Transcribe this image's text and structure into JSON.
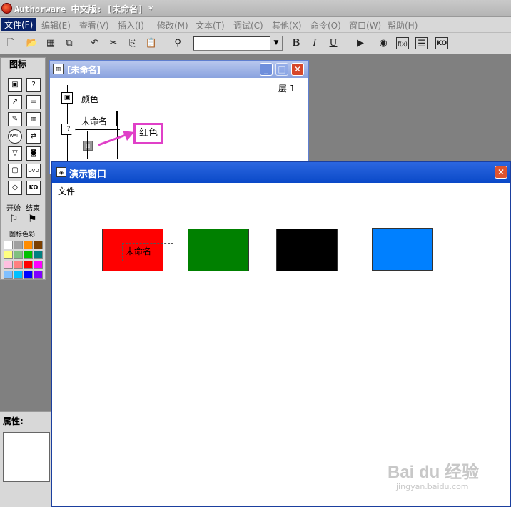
{
  "app": {
    "title": "Authorware 中文版: [未命名] *"
  },
  "menubar": {
    "items": [
      "文件(F)",
      "编辑(E)",
      "查看(V)",
      "插入(I)",
      "修改(M)",
      "文本(T)",
      "调试(C)",
      "其他(X)",
      "命令(O)",
      "窗口(W)",
      "帮助(H)"
    ]
  },
  "toolbar": {
    "font_combo_value": "",
    "bold_label": "B",
    "italic_label": "I",
    "underline_label": "U"
  },
  "palette": {
    "title": "图标",
    "start_label": "开始",
    "end_label": "结束",
    "colors_label": "图标色彩",
    "swatch_colors": [
      "#ffffff",
      "#a0a0a0",
      "#ff8c00",
      "#7b3f00",
      "#ffff80",
      "#80c080",
      "#00c000",
      "#008080",
      "#ffc0e0",
      "#ff8080",
      "#ff0000",
      "#ff00ff",
      "#80c0ff",
      "#00c0ff",
      "#0000ff",
      "#8000ff"
    ]
  },
  "properties": {
    "title": "属性: "
  },
  "flow_window": {
    "title": "[未命名]",
    "level_label": "层 1",
    "icon_color_label": "颜色",
    "interaction_label": "未命名",
    "callout_label": "红色"
  },
  "present_window": {
    "title": "演示窗口",
    "menu_file": "文件",
    "button_label": "未命名",
    "rects": [
      {
        "color": "#ff0000"
      },
      {
        "color": "#008000"
      },
      {
        "color": "#000000"
      },
      {
        "color": "#0080ff"
      }
    ]
  },
  "watermark": {
    "brand": "Bai du 经验",
    "url": "jingyan.baidu.com"
  }
}
